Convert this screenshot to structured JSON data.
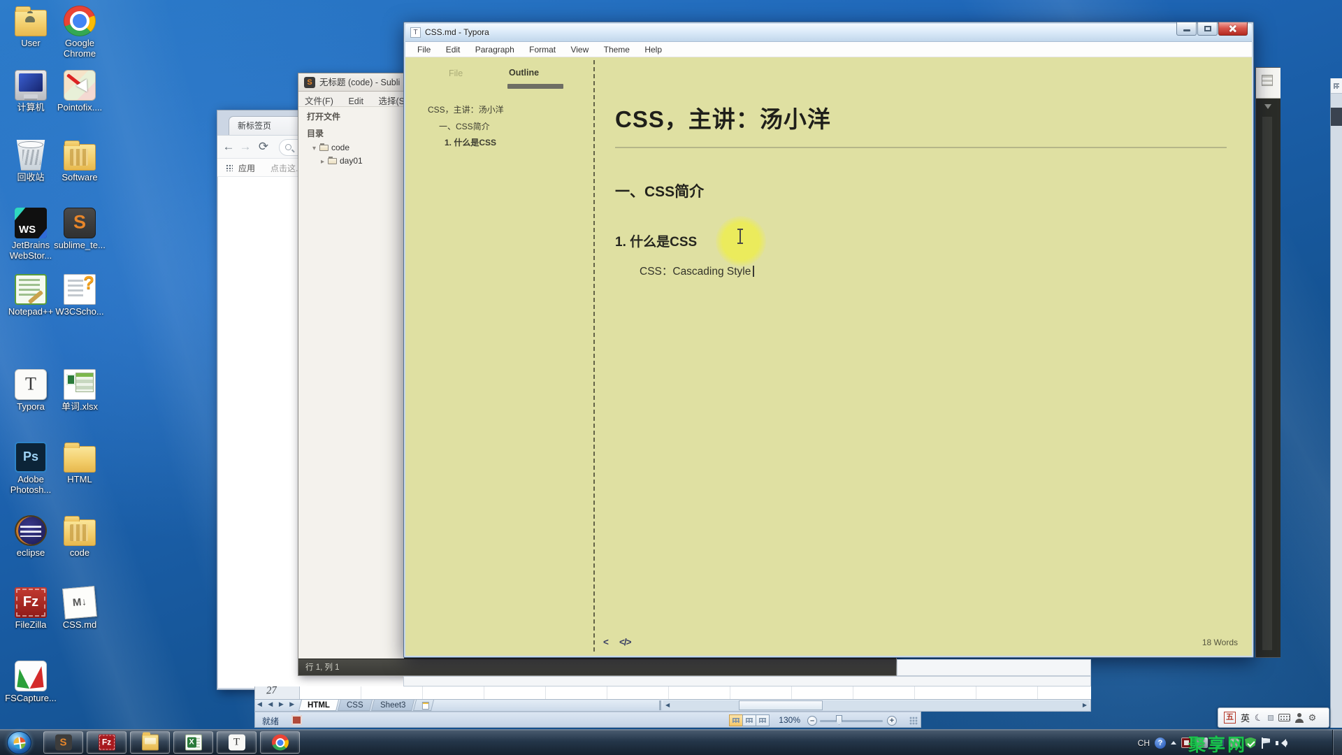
{
  "desktop": {
    "icons": [
      {
        "name": "user",
        "label": "User"
      },
      {
        "name": "google-chrome",
        "label": "Google Chrome"
      },
      {
        "name": "computer",
        "label": "计算机"
      },
      {
        "name": "pointofix",
        "label": "Pointofix...."
      },
      {
        "name": "recycle-bin",
        "label": "回收站"
      },
      {
        "name": "software-folder",
        "label": "Software"
      },
      {
        "name": "jetbrains-webstorm",
        "label": "JetBrains WebStor..."
      },
      {
        "name": "sublime-text",
        "label": "sublime_te..."
      },
      {
        "name": "notepad-plus-plus",
        "label": "Notepad++"
      },
      {
        "name": "w3cschool",
        "label": "W3CScho..."
      },
      {
        "name": "typora",
        "label": "Typora"
      },
      {
        "name": "words-xlsx",
        "label": "单词.xlsx"
      },
      {
        "name": "adobe-photoshop",
        "label": "Adobe Photosh..."
      },
      {
        "name": "html-folder",
        "label": "HTML"
      },
      {
        "name": "eclipse",
        "label": "eclipse"
      },
      {
        "name": "code-folder",
        "label": "code"
      },
      {
        "name": "filezilla",
        "label": "FileZilla"
      },
      {
        "name": "css-md",
        "label": "CSS.md"
      },
      {
        "name": "fscapture",
        "label": "FSCapture..."
      }
    ]
  },
  "chrome_window": {
    "tab_title": "新标签页",
    "apps_label": "应用",
    "hint_label": "点击这..."
  },
  "sublime_window": {
    "title": "无标题 (code) - Subli",
    "menus": [
      "文件(F)",
      "Edit",
      "选择(S)"
    ],
    "sidebar": {
      "open_files_label": "打开文件",
      "folders_label": "目录",
      "tree": [
        {
          "label": "code",
          "state": "expanded"
        },
        {
          "label": "day01",
          "state": "collapsed"
        }
      ]
    },
    "status": "行 1, 列 1"
  },
  "typora_window": {
    "title": "CSS.md - Typora",
    "icon_letter": "T",
    "menus": [
      "File",
      "Edit",
      "Paragraph",
      "Format",
      "View",
      "Theme",
      "Help"
    ],
    "sidebar_tabs": [
      "File",
      "Outline"
    ],
    "outline": [
      "CSS，主讲：汤小洋",
      "一、CSS简介",
      "1. 什么是CSS"
    ],
    "doc": {
      "h1": "CSS，主讲：汤小洋",
      "h2": "一、CSS简介",
      "h3": "1. 什么是CSS",
      "paragraph": "CSS：Cascading Style",
      "word_count": "18 Words"
    }
  },
  "excel_fragment": {
    "row_number": "27",
    "sheet_tabs": [
      "HTML",
      "CSS",
      "Sheet3"
    ],
    "active_sheet": "HTML",
    "status": "就绪",
    "zoom_level": "130%"
  },
  "taskbar": {
    "language_indicator": "CH",
    "watermark": "聚享网",
    "language_bar": {
      "wubi": "五",
      "english": "英"
    }
  },
  "icons": {
    "back": "←",
    "forward": "→",
    "reload": "⟳",
    "tree_expanded": "▾",
    "tree_collapsed": "▸",
    "nav_tabs": "◀ ◀ ▶ ▶",
    "scroll_left": "◀",
    "scroll_right": "▶",
    "sidebar_toggle": "<",
    "source_mode": "</>",
    "moon": "☾",
    "tools": "⚙",
    "help": "?",
    "minus": "–",
    "plus": "+"
  },
  "colors": {
    "typora_background": "#dfe0a2",
    "cursor_halo": "#ebeb5c",
    "desktop_blue": "#1f67b8",
    "taskbar_dark": "#16222f",
    "watermark_green": "#17cf4b"
  }
}
